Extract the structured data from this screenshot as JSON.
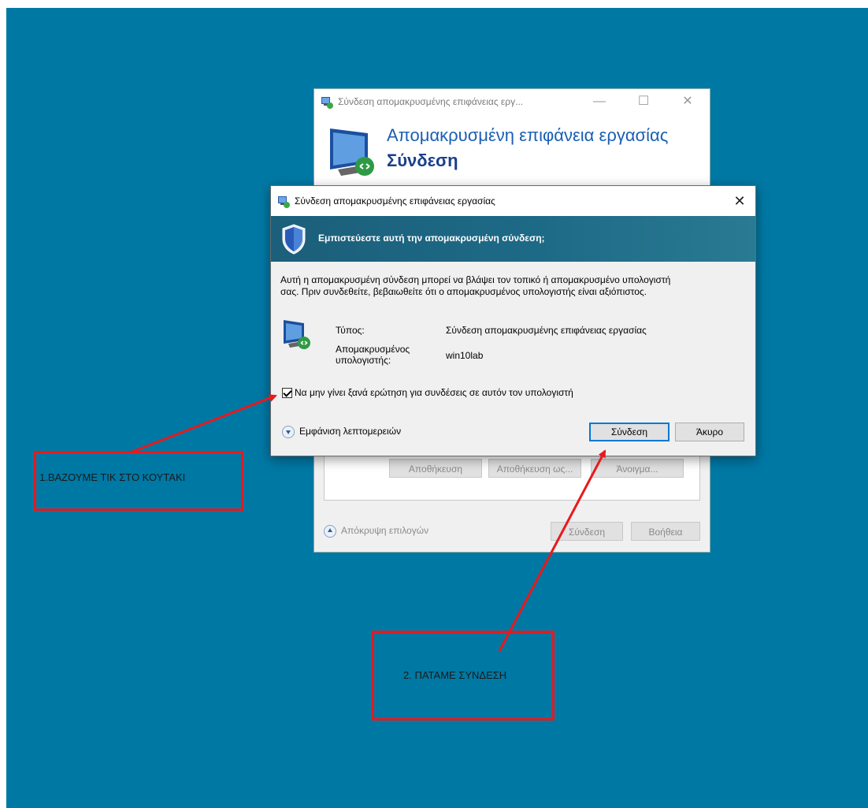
{
  "back_window": {
    "title": "Σύνδεση απομακρυσμένης επιφάνειας εργ...",
    "heading1": "Απομακρυσμένη επιφάνεια εργασίας",
    "heading2": "Σύνδεση",
    "save_button": "Αποθήκευση",
    "save_as_button": "Αποθήκευση ως...",
    "open_button": "Άνοιγμα...",
    "hide_options": "Απόκρυψη επιλογών",
    "connect_button": "Σύνδεση",
    "help_button": "Βοήθεια"
  },
  "dialog": {
    "title": "Σύνδεση απομακρυσμένης επιφάνειας εργασίας",
    "banner": "Εμπιστεύεστε αυτή την απομακρυσμένη σύνδεση;",
    "desc_line1": "Αυτή η απομακρυσμένη σύνδεση μπορεί να βλάψει τον τοπικό ή απομακρυσμένο υπολογιστή",
    "desc_line2": "σας. Πριν συνδεθείτε, βεβαιωθείτε ότι ο απομακρυσμένος υπολογιστής είναι αξιόπιστος.",
    "type_label": "Τύπος:",
    "type_value": "Σύνδεση απομακρυσμένης επιφάνειας εργασίας",
    "remote_label_line1": "Απομακρυσμένος",
    "remote_label_line2": "υπολογιστής:",
    "remote_value": "win10lab",
    "checkbox_label": "Να μην γίνει ξανά ερώτηση για συνδέσεις σε αυτόν τον υπολογιστή",
    "checkbox_checked": true,
    "show_details": "Εμφάνιση λεπτομερειών",
    "connect_button": "Σύνδεση",
    "cancel_button": "Άκυρο"
  },
  "annotations": {
    "step1": "1.ΒΑΖΟΥΜΕ ΤΙΚ ΣΤΟ ΚΟΥΤΑΚΙ",
    "step2": "2. ΠΑΤΑΜΕ ΣΥΝΔΕΣΗ",
    "color": "#e8191d"
  },
  "colors": {
    "desktop": "#0078a4",
    "banner": "#1d6a86",
    "heading_blue": "#1a5fb4"
  }
}
